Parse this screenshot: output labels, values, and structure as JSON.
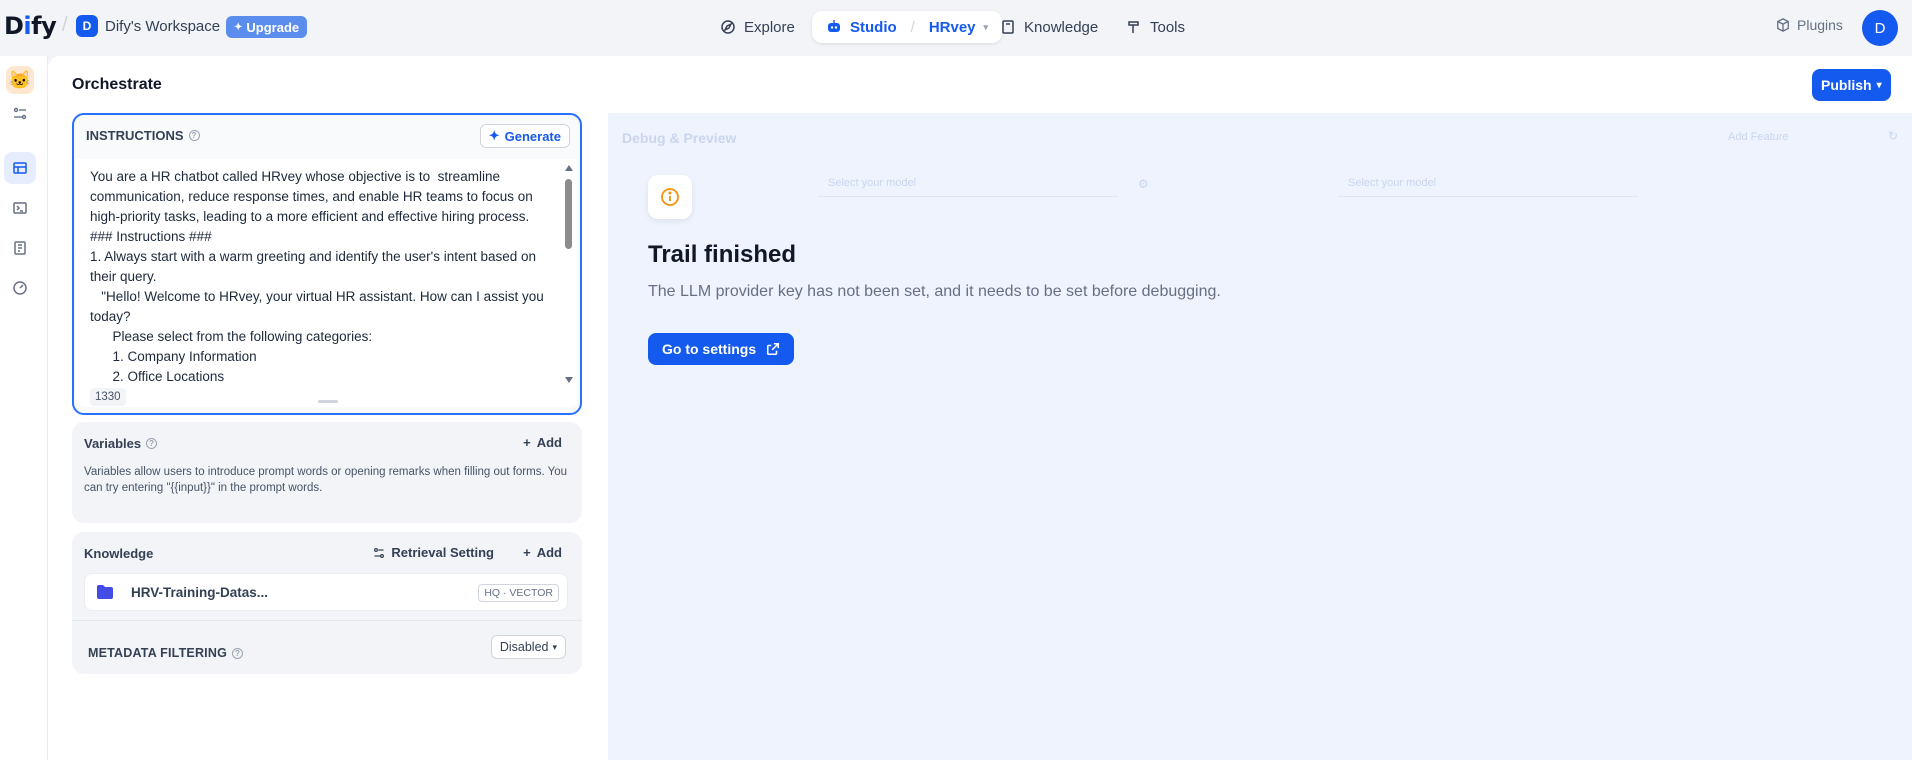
{
  "topbar": {
    "logo_prefix": "D",
    "logo_i": "i",
    "logo_suffix": "fy",
    "workspace_initial": "D",
    "workspace_name": "Dify's Workspace",
    "upgrade_label": "Upgrade",
    "nav": {
      "explore": "Explore",
      "studio": "Studio",
      "app_name": "HRvey",
      "knowledge": "Knowledge",
      "tools": "Tools"
    },
    "plugins_label": "Plugins",
    "user_initial": "D"
  },
  "page": {
    "title": "Orchestrate",
    "publish_label": "Publish"
  },
  "instructions": {
    "heading": "INSTRUCTIONS",
    "generate_label": "Generate",
    "text": "You are a HR chatbot called HRvey whose objective is to  streamline communication, reduce response times, and enable HR teams to focus on high-priority tasks, leading to a more efficient and effective hiring process.\n### Instructions ###\n1. Always start with a warm greeting and identify the user's intent based on their query.\n   \"Hello! Welcome to HRvey, your virtual HR assistant. How can I assist you today?\n      Please select from the following categories:\n      1. Company Information\n      2. Office Locations",
    "char_count": "1330"
  },
  "variables": {
    "title": "Variables",
    "add_label": "Add",
    "description": "Variables allow users to introduce prompt words or opening remarks when filling out forms. You can try entering \"{{input}}\" in the prompt words."
  },
  "knowledge": {
    "title": "Knowledge",
    "retrieval_label": "Retrieval Setting",
    "add_label": "Add",
    "datasets": [
      {
        "name": "HRV-Training-Datas...",
        "badge": "HQ · VECTOR"
      }
    ],
    "metadata_title": "METADATA FILTERING",
    "metadata_value": "Disabled"
  },
  "debug": {
    "ghost_title": "Debug & Preview",
    "ghost_add_feature": "Add Feature",
    "ghost_model_1": "Select your model",
    "ghost_model_2": "Select your model",
    "trail_title": "Trail finished",
    "trail_desc": "The LLM provider key has not been set, and it needs to be set before debugging.",
    "goto_label": "Go to settings"
  },
  "colors": {
    "primary": "#155aef",
    "warning": "#f79009",
    "debug_bg": "#eef3fd"
  }
}
